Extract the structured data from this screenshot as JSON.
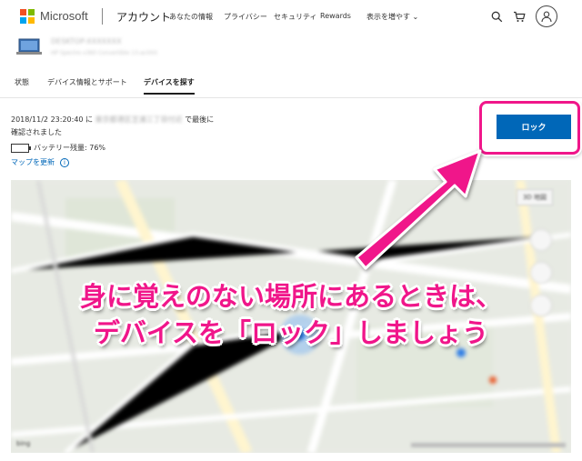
{
  "header": {
    "brand": "Microsoft",
    "account": "アカウント",
    "nav": [
      "あなたの情報",
      "プライバシー",
      "セキュリティ",
      "Rewards",
      "表示を増やす"
    ],
    "more_chevron": "⌄",
    "icons": [
      "search-icon",
      "cart-icon",
      "user-avatar-icon"
    ],
    "logo_colors": [
      "#f25022",
      "#7fba00",
      "#00a4ef",
      "#ffb900"
    ]
  },
  "device": {
    "name": "DESKTOP-XXXXXXX",
    "model": "HP Spectre x360 Convertible 13-ac0XX"
  },
  "tabs": [
    {
      "label": "状態",
      "active": false
    },
    {
      "label": "デバイス情報とサポート",
      "active": false
    },
    {
      "label": "デバイスを探す",
      "active": true
    }
  ],
  "status": {
    "timestamp": "2018/11/2 23:20:40 に",
    "address": "東京都港区芝浦三丁目付近",
    "last_seen_suffix": "で最後に",
    "confirmed": "確認されました",
    "battery_label": "バッテリー残量: 76%",
    "battery_level": 0.76,
    "refresh_map": "マップを更新",
    "info_glyph": "i"
  },
  "lock_button": {
    "label": "ロック",
    "color": "#0067b8"
  },
  "map": {
    "view_toggle": "3D 地図",
    "provider": "bing"
  },
  "annotation": {
    "line1": "身に覚えのない場所にあるときは、",
    "line2": "デバイスを「ロック」しましょう",
    "color": "#f0168a"
  }
}
